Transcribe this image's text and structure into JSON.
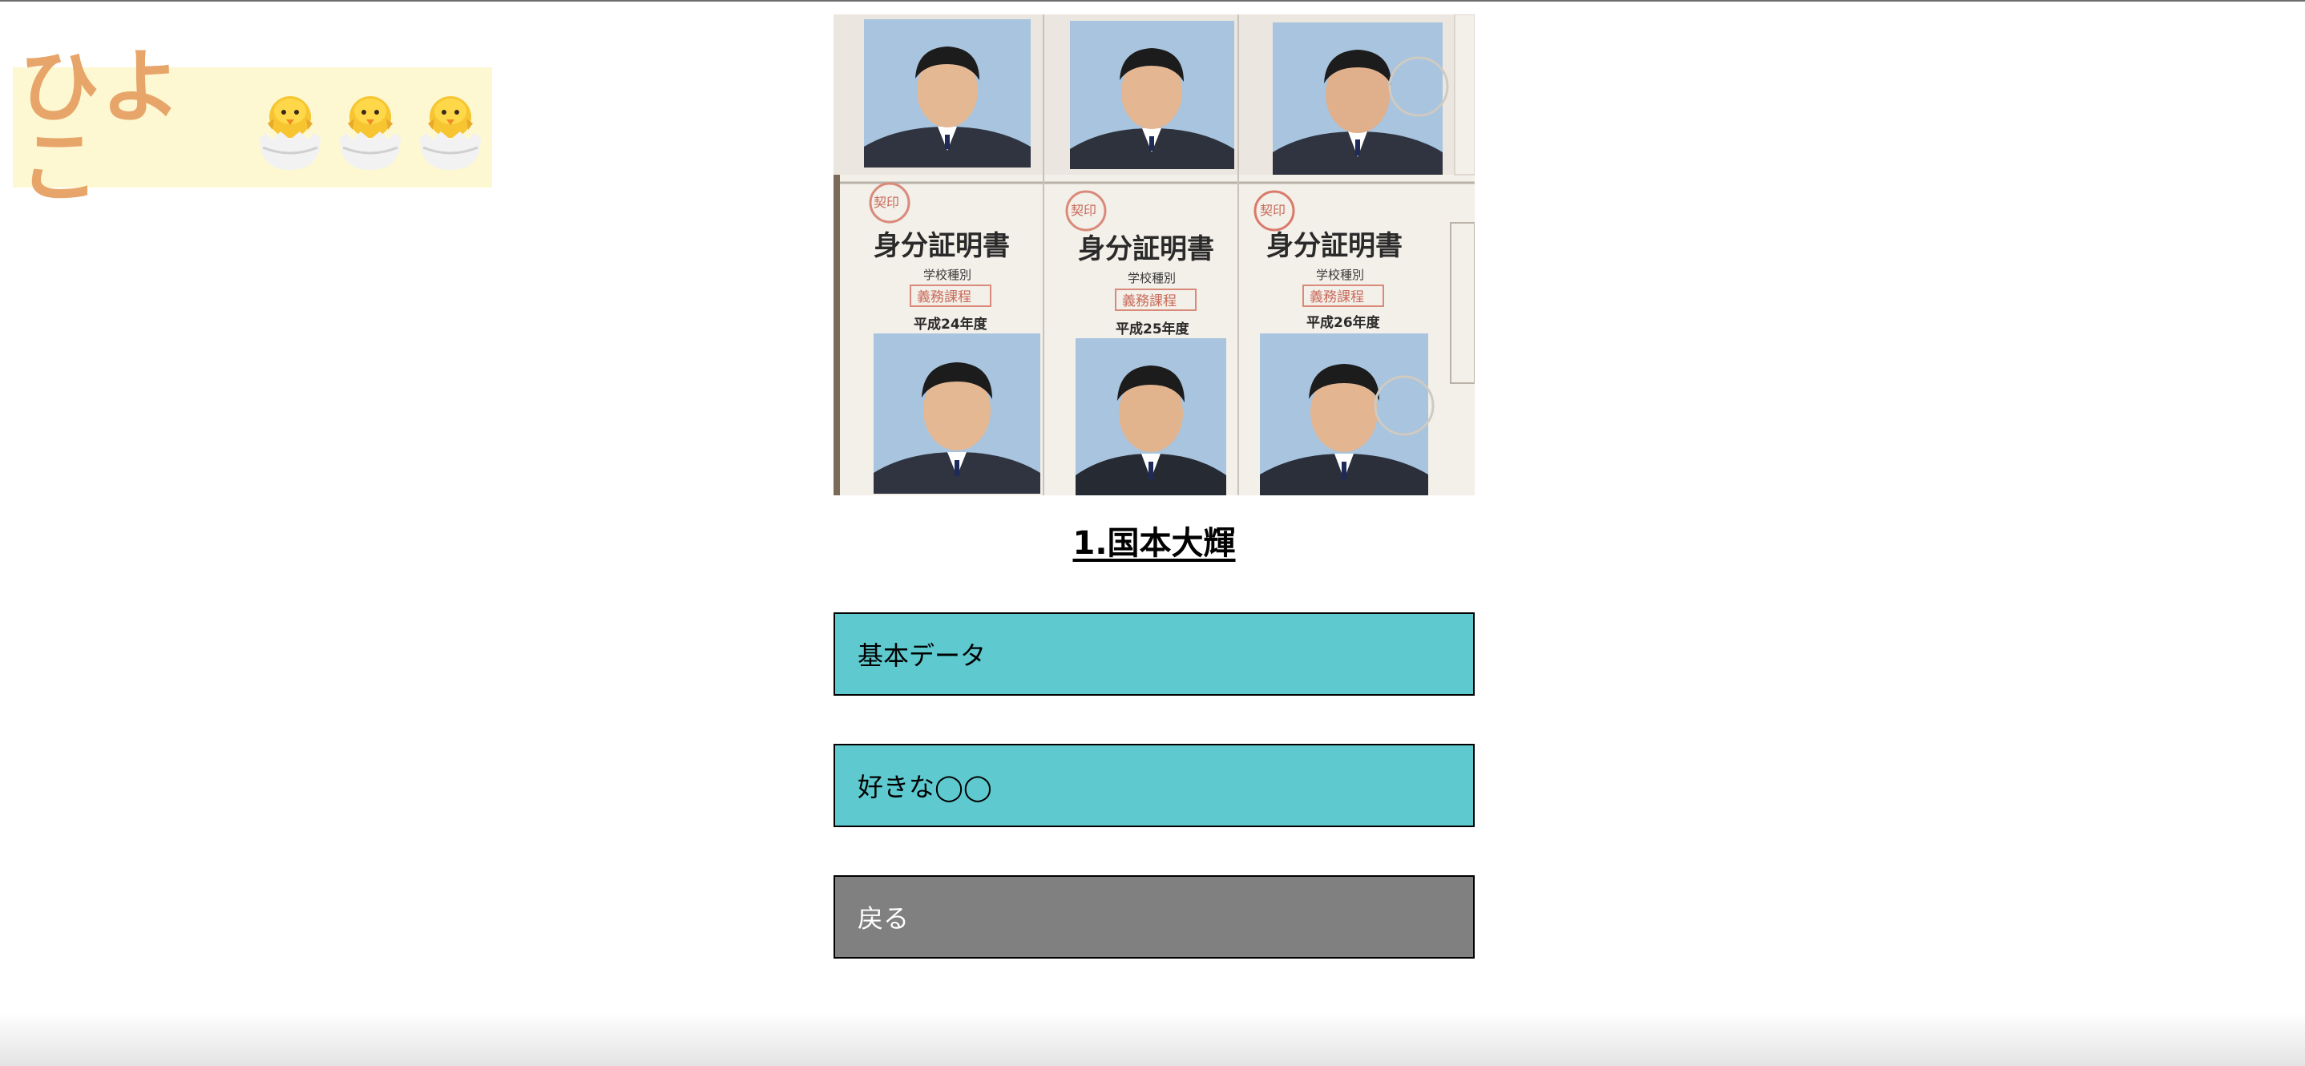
{
  "header": {
    "logo_text": "ひよこ",
    "logo_icons": [
      "hatching-chick-icon",
      "hatching-chick-icon",
      "hatching-chick-icon"
    ],
    "logo_bg": "#fdf8d2",
    "logo_color": "#e8a56a"
  },
  "photo": {
    "cards": [
      {
        "heading": "身分証明書",
        "school_type_label": "学校種別",
        "stamp": "義務課程",
        "year": "平成24年度",
        "seal": "契印"
      },
      {
        "heading": "身分証明書",
        "school_type_label": "学校種別",
        "stamp": "義務課程",
        "year": "平成25年度",
        "seal": "契印"
      },
      {
        "heading": "身分証明書",
        "school_type_label": "学校種別",
        "stamp": "義務課程",
        "year": "平成26年度",
        "seal": "契印"
      }
    ]
  },
  "main": {
    "title": "1.国本大輝",
    "buttons": [
      {
        "label": "基本データ",
        "color": "#5ecad0"
      },
      {
        "label": "好きな◯◯",
        "color": "#5ecad0"
      },
      {
        "label": "戻る",
        "color": "#808080"
      }
    ]
  }
}
